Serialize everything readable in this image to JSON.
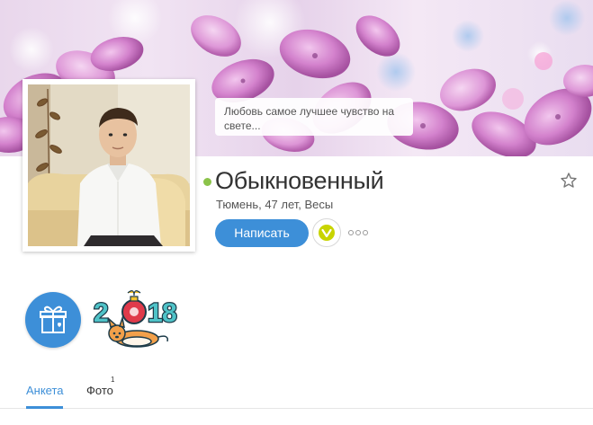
{
  "profile": {
    "status_text": "Любовь самое лучшее чувство на свете...",
    "name": "Обыкновенный",
    "info": "Тюмень, 47 лет, Весы",
    "online": true
  },
  "actions": {
    "write_label": "Написать",
    "favorite_icon": "star-icon",
    "vip_icon": "vip-check-icon",
    "more_icon": "more-dots-icon"
  },
  "gifts": {
    "gift_icon": "gift-icon",
    "badge_text": "2018"
  },
  "tabs": [
    {
      "label": "Анкета",
      "active": true
    },
    {
      "label": "Фото",
      "count": "1",
      "active": false
    }
  ],
  "colors": {
    "accent": "#3d8fd8",
    "online": "#8bc34a",
    "vip": "#c8d400"
  }
}
